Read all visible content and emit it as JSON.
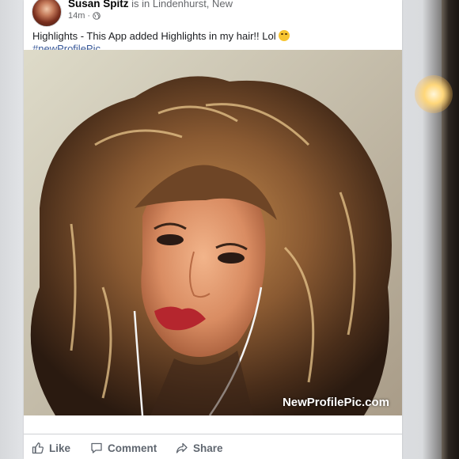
{
  "post": {
    "author": "Susan Spitz",
    "location_text": "is in Lindenhurst, New",
    "time": "14m",
    "privacy_icon": "globe-icon",
    "caption": "Highlights  - This App added Highlights in my hair!! Lol",
    "caption_emoji": "laughing-emoji-icon",
    "hashtag": "#newProfilePic",
    "photo_watermark": "NewProfilePic.com"
  },
  "actions": {
    "like_label": "Like",
    "comment_label": "Comment",
    "share_label": "Share"
  },
  "colors": {
    "link": "#385898",
    "text": "#1c1e21",
    "secondary": "#606770"
  }
}
